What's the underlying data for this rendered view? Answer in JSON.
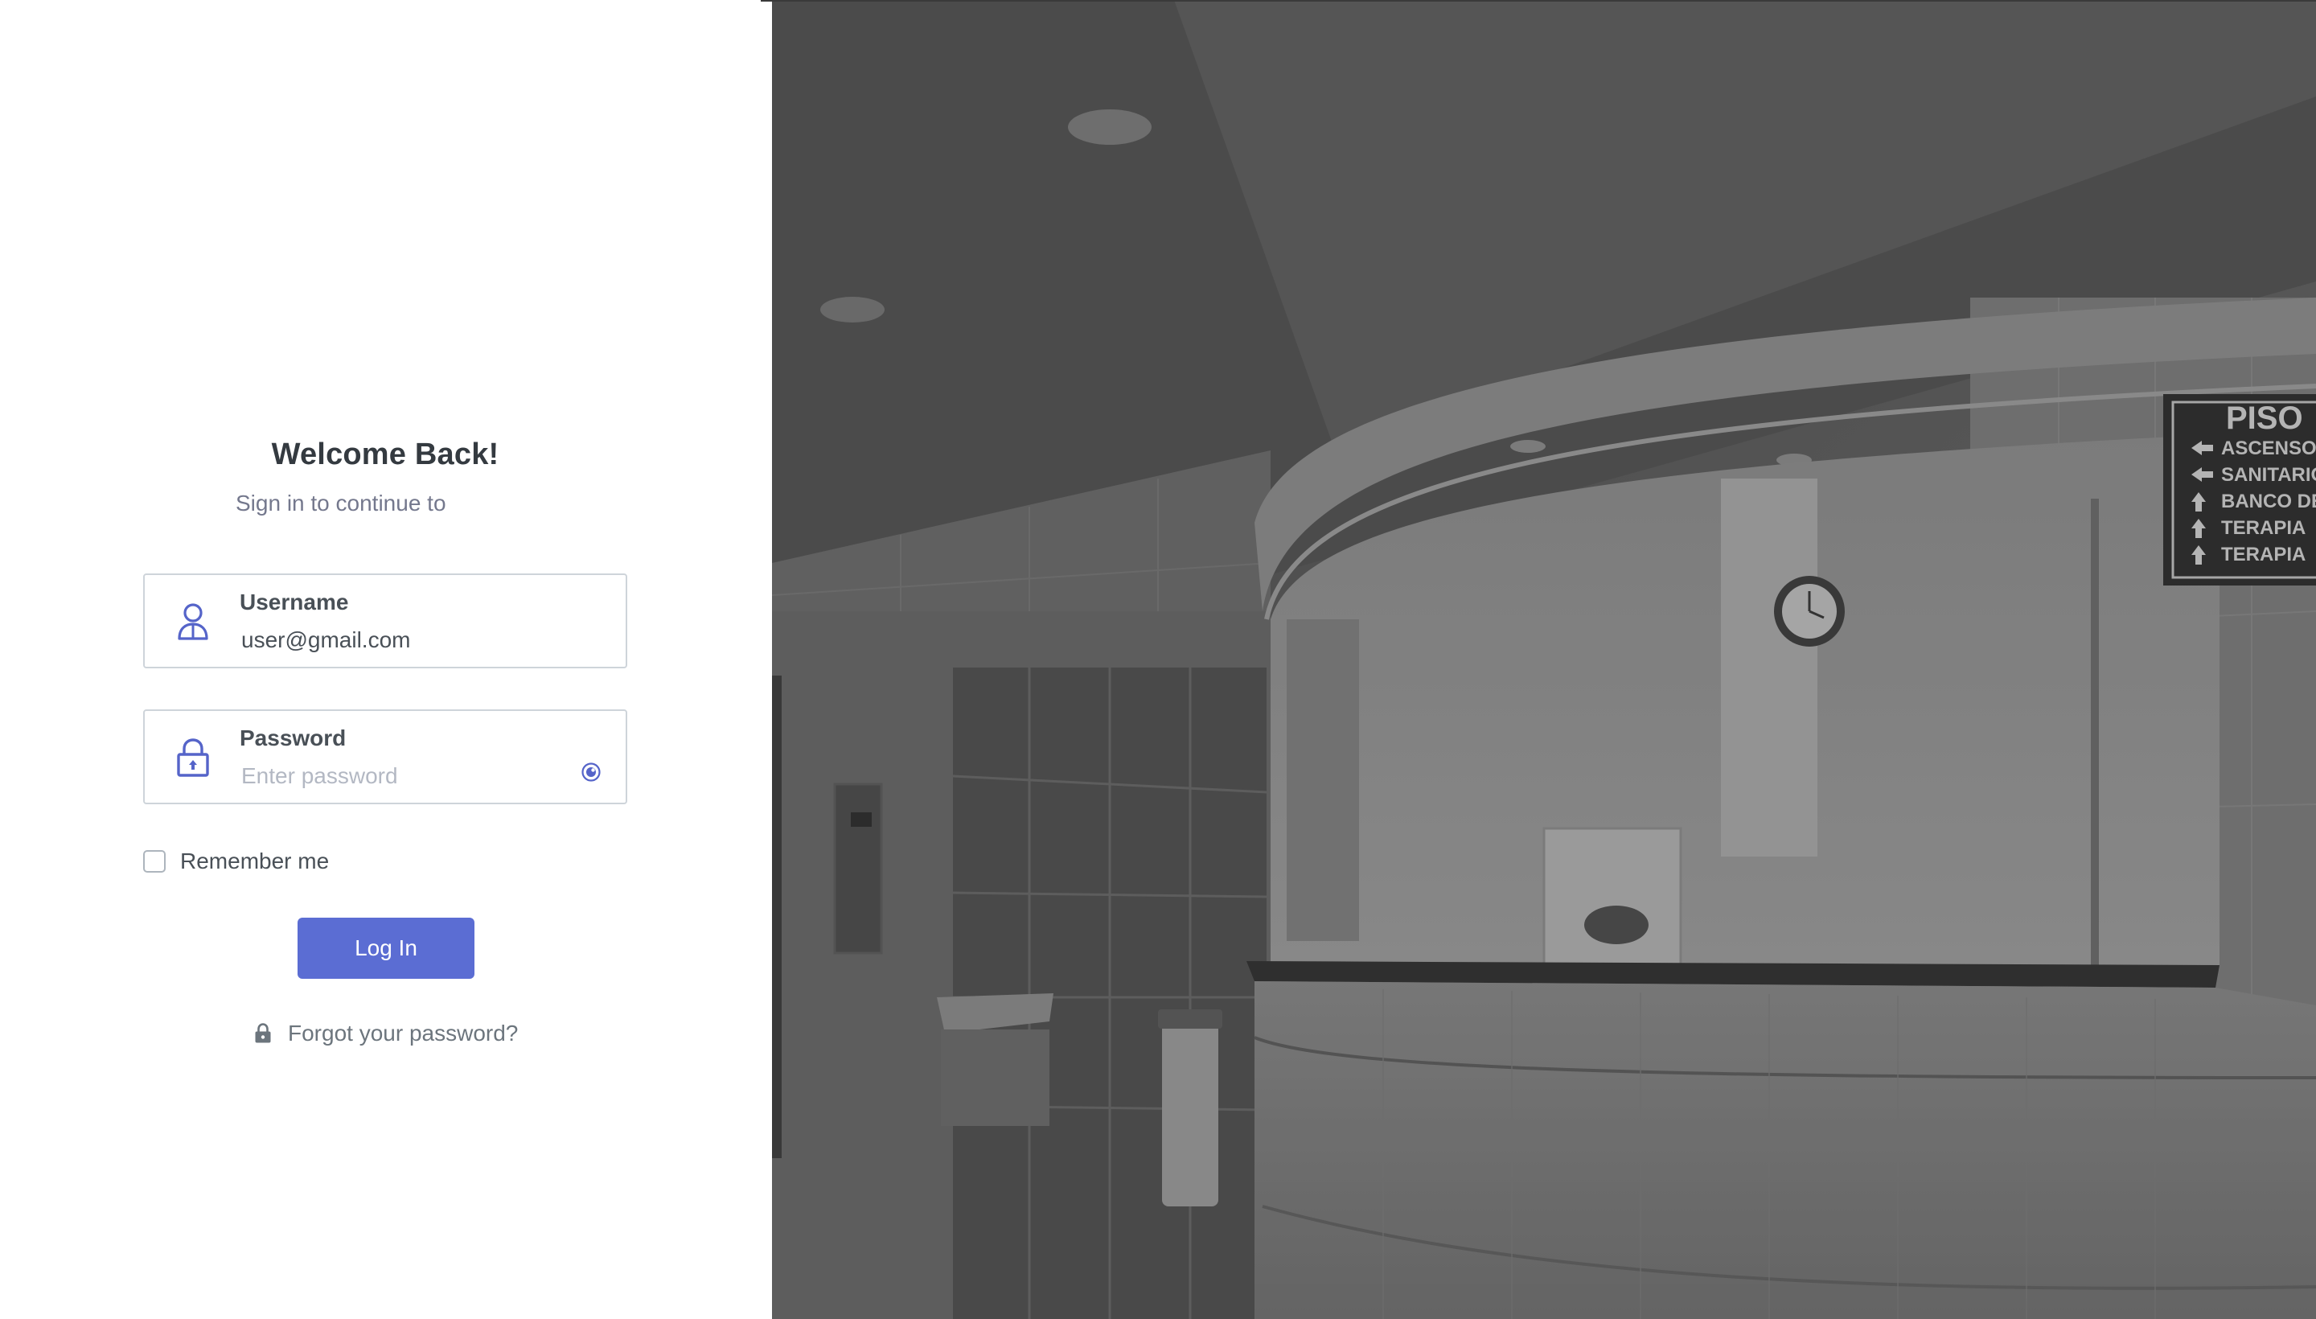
{
  "login": {
    "title": "Welcome Back!",
    "subtitle": "Sign in to continue to",
    "username": {
      "label": "Username",
      "value": "user@gmail.com",
      "icon": "user-icon"
    },
    "password": {
      "label": "Password",
      "placeholder": "Enter password",
      "icon": "lock-icon",
      "toggle_icon": "eye-icon"
    },
    "remember_label": "Remember me",
    "remember_checked": false,
    "login_button": "Log In",
    "forgot_label": "Forgot your password?",
    "forgot_icon": "lock-icon"
  },
  "background_image": {
    "subject": "hospital reception desk",
    "sign_lines": [
      "PISO",
      "ASCENSOR",
      "SANITARIO",
      "BANCO DE",
      "TERAPIA",
      "TERAPIA"
    ]
  },
  "colors": {
    "primary": "#5b6dd3",
    "icon": "#5564c9",
    "text": "#495057",
    "muted": "#74788d",
    "overlay": "#555555"
  }
}
